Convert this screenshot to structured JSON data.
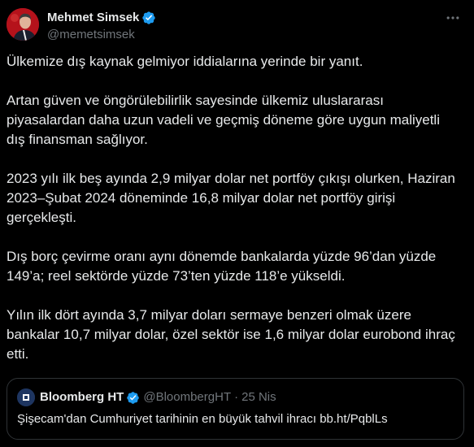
{
  "author": {
    "display_name": "Mehmet Simsek",
    "handle": "@memetsimsek",
    "verified": true
  },
  "icons": {
    "verified": "verified-badge-icon",
    "more": "more-options-icon"
  },
  "colors": {
    "background": "#000000",
    "text_primary": "#e7e9ea",
    "text_secondary": "#71767b",
    "verified_blue": "#1d9bf0",
    "border": "#2f3336"
  },
  "tweet": {
    "paragraphs": [
      "Ülkemize dış kaynak gelmiyor iddialarına yerinde bir yanıt.",
      "Artan güven ve öngörülebilirlik sayesinde ülkemiz uluslararası\npiyasalardan daha uzun vadeli ve geçmiş döneme göre uygun maliyetli\ndış finansman sağlıyor.",
      "2023 yılı ilk beş ayında 2,9 milyar dolar net portföy çıkışı olurken, Haziran\n2023–Şubat 2024 döneminde 16,8 milyar dolar net portföy girişi\ngerçekleşti.",
      "Dış borç çevirme oranı aynı dönemde bankalarda yüzde 96’dan yüzde\n149’a; reel sektörde yüzde 73’ten yüzde 118’e yükseldi.",
      "Yılın ilk dört ayında 3,7 milyar doları sermaye benzeri olmak üzere\nbankalar 10,7 milyar dolar, özel sektör ise 1,6 milyar dolar eurobond ihraç\netti."
    ]
  },
  "quote": {
    "display_name": "Bloomberg HT",
    "handle": "@BloombergHT",
    "separator": "·",
    "date": "25 Nis",
    "text": "Şişecam'dan Cumhuriyet tarihinin en büyük tahvil ihracı bb.ht/PqblLs",
    "verified": true
  }
}
